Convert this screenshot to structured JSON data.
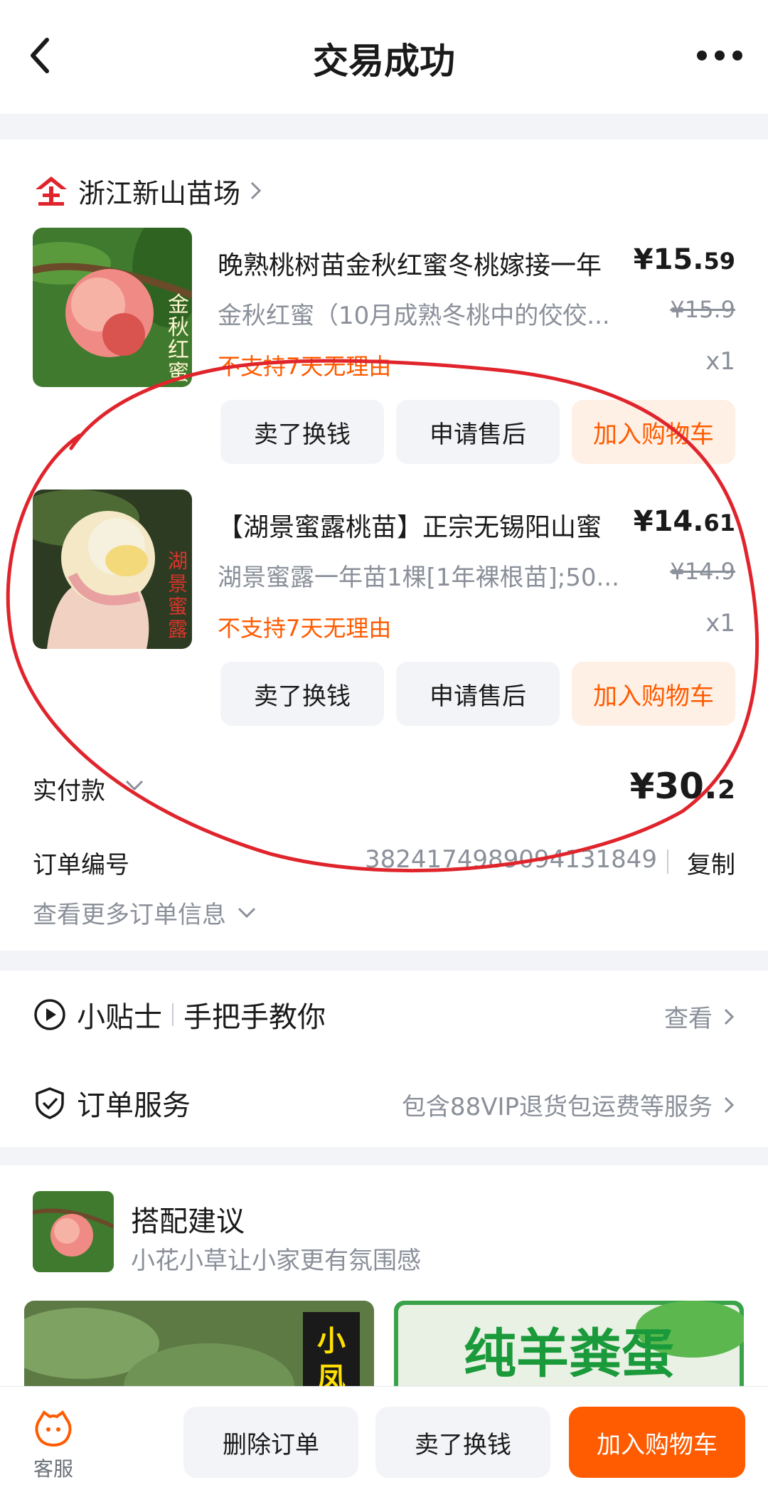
{
  "header": {
    "title": "交易成功"
  },
  "shop": {
    "name": "浙江新山苗场"
  },
  "items": [
    {
      "name": "晚熟桃树苗金秋红蜜冬桃嫁接一年",
      "price_int": "¥15.",
      "price_dec": "59",
      "variant": "金秋红蜜（10月成熟冬桃中的佼佼...",
      "original_price": "¥15.9",
      "warning": "不支持7天无理由",
      "qty": "x1",
      "thumb_text": "金秋红蜜",
      "buttons": [
        "卖了换钱",
        "申请售后",
        "加入购物车"
      ]
    },
    {
      "name": "【湖景蜜露桃苗】正宗无锡阳山蜜",
      "price_int": "¥14.",
      "price_dec": "61",
      "variant": "湖景蜜露一年苗1棵[1年裸根苗];50...",
      "original_price": "¥14.9",
      "warning": "不支持7天无理由",
      "qty": "x1",
      "thumb_text": "湖景蜜露",
      "buttons": [
        "卖了换钱",
        "申请售后",
        "加入购物车"
      ]
    }
  ],
  "payment": {
    "label": "实付款",
    "amount_int": "¥30.",
    "amount_dec": "2"
  },
  "order": {
    "label": "订单编号",
    "number": "3824174989094131849",
    "copy": "复制",
    "more": "查看更多订单信息"
  },
  "services": {
    "tips_label": "小贴士",
    "tips_sub": "手把手教你",
    "tips_action": "查看",
    "order_service_label": "订单服务",
    "order_service_desc": "包含88VIP退货包运费等服务"
  },
  "recommend": {
    "title": "搭配建议",
    "subtitle": "小花小草让小家更有氛围感",
    "img1_text": "小凤",
    "img2_text": "纯羊粪蛋"
  },
  "bottom": {
    "cs_label": "客服",
    "delete": "删除订单",
    "resell": "卖了换钱",
    "add_cart": "加入购物车"
  },
  "colors": {
    "accent": "#ff5b00",
    "annotation": "#e0242c"
  }
}
